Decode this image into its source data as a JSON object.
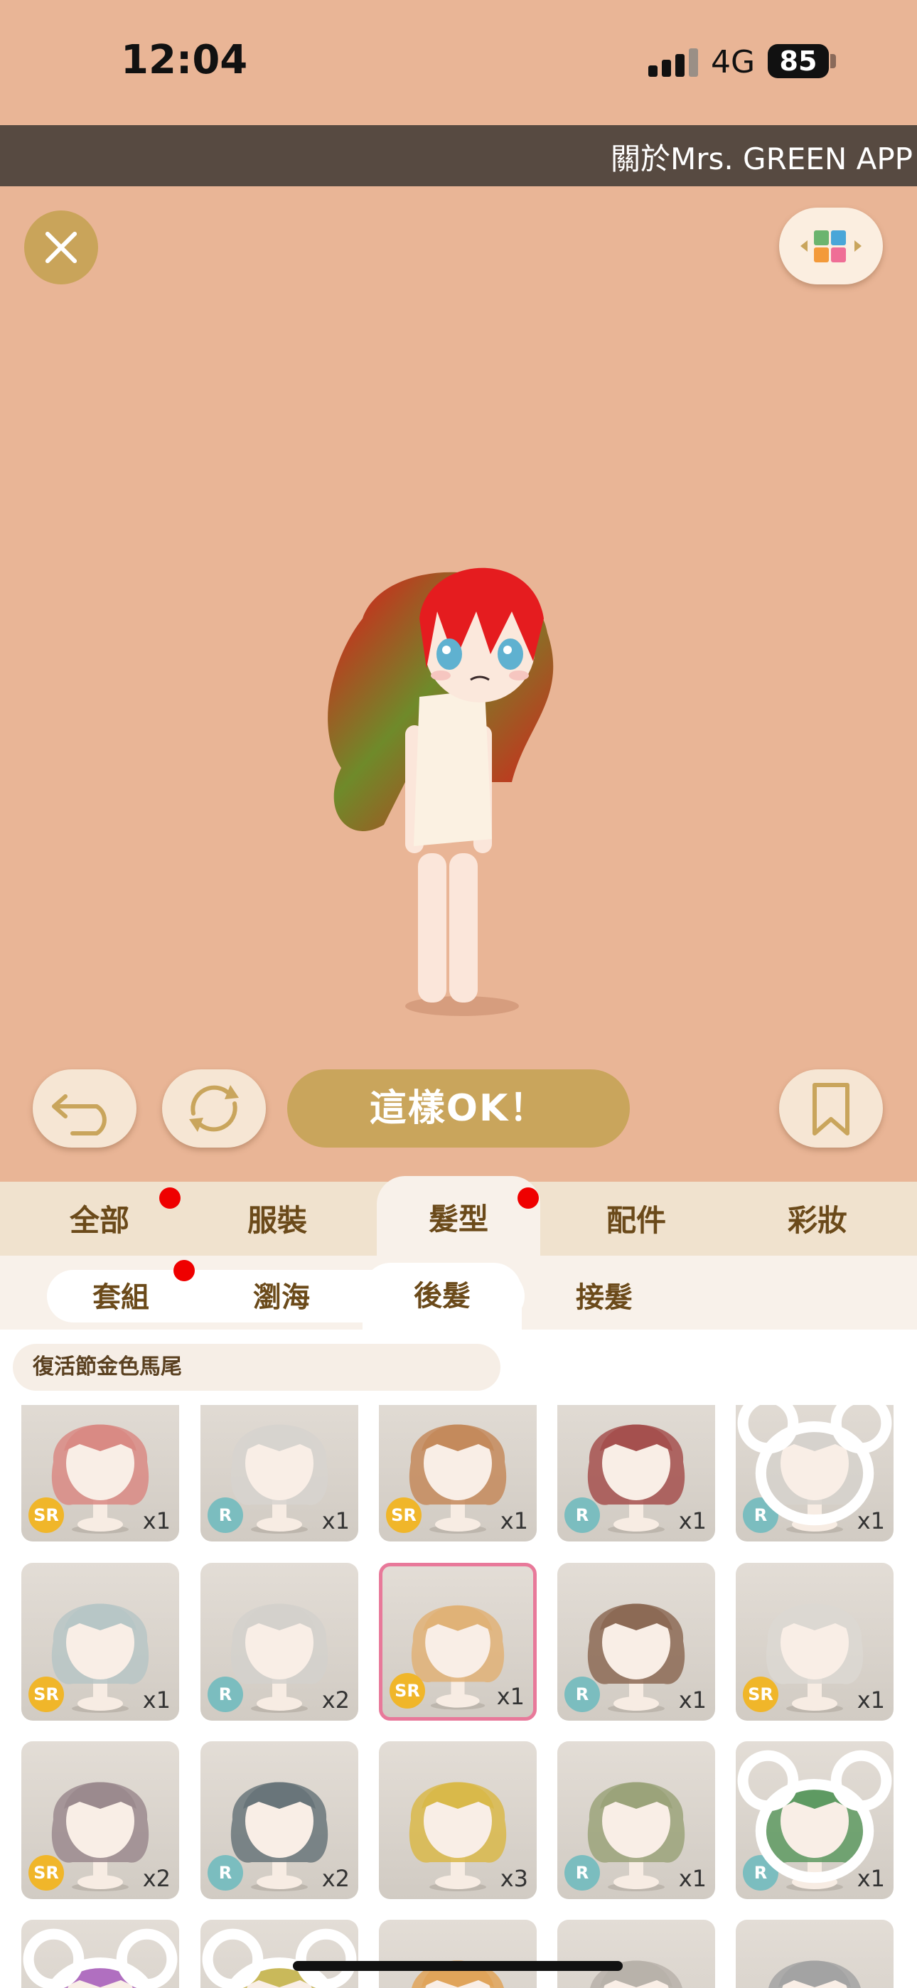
{
  "status": {
    "time": "12:04",
    "network": "4G",
    "battery": "85"
  },
  "banner": {
    "text": "關於Mrs. GREEN APP"
  },
  "actions": {
    "ok_label": "這樣OK！"
  },
  "categories": [
    {
      "label": "全部",
      "dot": true
    },
    {
      "label": "服裝",
      "dot": false
    },
    {
      "label": "髮型",
      "dot": true,
      "active": true
    },
    {
      "label": "配件",
      "dot": false
    },
    {
      "label": "彩妝",
      "dot": false
    }
  ],
  "subtabs": [
    {
      "label": "套組",
      "dot": true
    },
    {
      "label": "瀏海",
      "dot": false
    },
    {
      "label": "後髮",
      "active": true
    },
    {
      "label": "接髮",
      "dot": false
    }
  ],
  "selected_item": {
    "name": "復活節金色馬尾"
  },
  "items": [
    {
      "rarity": "SR",
      "count": "x1",
      "hair": "#d98a84",
      "bear": false
    },
    {
      "rarity": "R",
      "count": "x1",
      "hair": "#d7d4cf",
      "bear": false
    },
    {
      "rarity": "SR",
      "count": "x1",
      "hair": "#c48a5c",
      "bear": false
    },
    {
      "rarity": "R",
      "count": "x1",
      "hair": "#a5504e",
      "bear": false
    },
    {
      "rarity": "R",
      "count": "x1",
      "hair": "#d6d2cd",
      "bear": true
    },
    {
      "rarity": "SR",
      "count": "x1",
      "hair": "#b7c6c6",
      "bear": false
    },
    {
      "rarity": "R",
      "count": "x2",
      "hair": "#d4d1cc",
      "bear": false
    },
    {
      "rarity": "SR",
      "count": "x1",
      "hair": "#e0b277",
      "bear": false,
      "selected": true
    },
    {
      "rarity": "R",
      "count": "x1",
      "hair": "#8c6a55",
      "bear": false
    },
    {
      "rarity": "SR",
      "count": "x1",
      "hair": "#dcd8d2",
      "bear": false
    },
    {
      "rarity": "SR",
      "count": "x2",
      "hair": "#9b8a8e",
      "bear": false
    },
    {
      "rarity": "R",
      "count": "x2",
      "hair": "#69757a",
      "bear": false
    },
    {
      "rarity": "",
      "count": "x3",
      "hair": "#d9b94a",
      "bear": false
    },
    {
      "rarity": "R",
      "count": "x1",
      "hair": "#9ba37a",
      "bear": false
    },
    {
      "rarity": "R",
      "count": "x1",
      "hair": "#5e9a62",
      "bear": true
    },
    {
      "rarity": "",
      "count": "",
      "hair": "#b06fc0",
      "bear": true
    },
    {
      "rarity": "",
      "count": "",
      "hair": "#c9b95a",
      "bear": true
    },
    {
      "rarity": "",
      "count": "",
      "hair": "#e0a45a",
      "bear": false
    },
    {
      "rarity": "",
      "count": "",
      "hair": "#b8b2aa",
      "bear": false
    },
    {
      "rarity": "",
      "count": "",
      "hair": "#a3a3a3",
      "bear": false
    }
  ],
  "colors": {
    "bg": "#e9b596",
    "accent": "#c9a55c",
    "dot": "#ef0000",
    "selected_border": "#e8799a"
  }
}
